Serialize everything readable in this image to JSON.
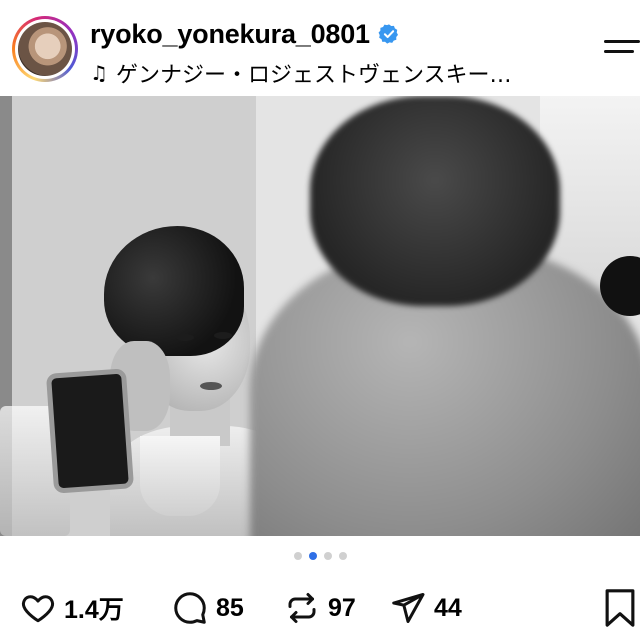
{
  "header": {
    "username": "ryoko_yonekura_0801",
    "verified": true,
    "music": {
      "icon": "music-note-icon",
      "title": "ゲンナジー・ロジェストヴェンスキー…"
    },
    "menu_icon": "menu-icon"
  },
  "post": {
    "image_description_icon": "photo",
    "mute_icon": "volume-off-icon",
    "carousel": {
      "total": 4,
      "active_index": 1
    }
  },
  "actions": {
    "like_count": "1.4万",
    "comment_count": "85",
    "repost_count": "97",
    "share_count": "44"
  },
  "colors": {
    "accent": "#2f6fe6",
    "verified": "#3897f0",
    "dot_inactive": "#d0d0d0"
  }
}
